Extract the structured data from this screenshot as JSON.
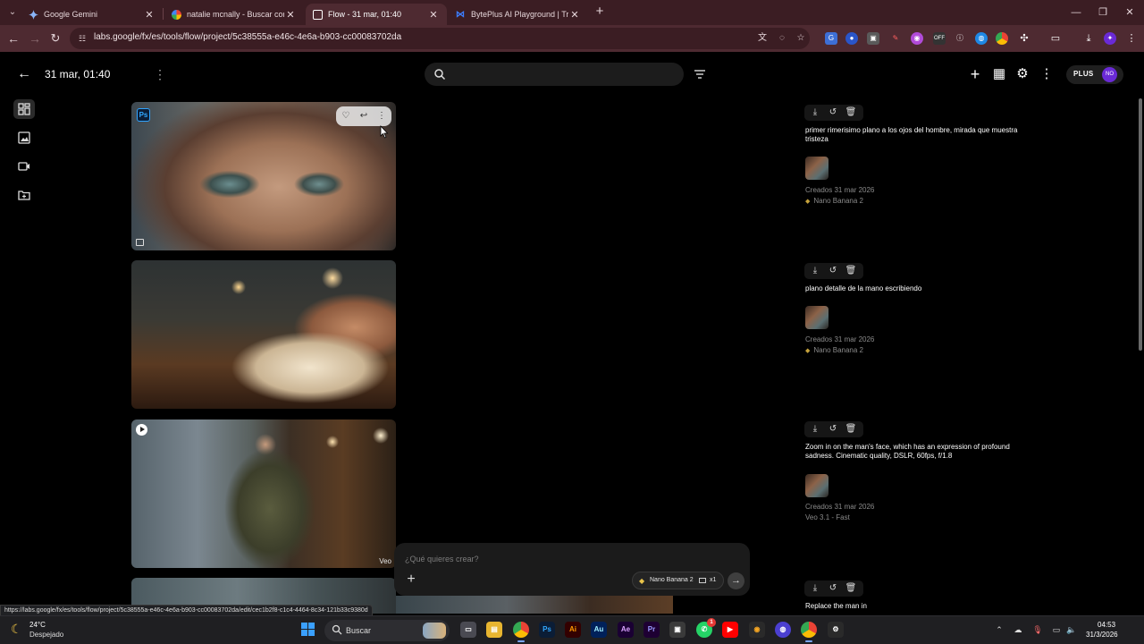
{
  "browser": {
    "tabs": [
      {
        "title": "Google Gemini",
        "active": false
      },
      {
        "title": "natalie mcnally - Buscar con Go",
        "active": false
      },
      {
        "title": "Flow - 31 mar, 01:40",
        "active": true
      },
      {
        "title": "BytePlus AI Playground | Try Ac",
        "active": false
      }
    ],
    "url": "labs.google/fx/es/tools/flow/project/5c38555a-e46c-4e6a-b903-cc00083702da"
  },
  "header": {
    "project_title": "31 mar, 01:40",
    "search_placeholder": "",
    "plan_badge": "PLUS",
    "avatar_text": "NO"
  },
  "gallery": {
    "items": [
      {
        "kind": "image",
        "badge": "Ps",
        "tag": ""
      },
      {
        "kind": "image",
        "badge": "",
        "tag": ""
      },
      {
        "kind": "video",
        "badge": "",
        "tag": "Veo"
      }
    ]
  },
  "composer": {
    "placeholder": "¿Qué quieres crear?",
    "model": "Nano Banana 2",
    "count": "x1"
  },
  "history": [
    {
      "prompt": "primer rimerisimo plano a los ojos del hombre, mirada que muestra tristeza",
      "date": "Creados 31 mar 2026",
      "model": "Nano Banana 2",
      "banana": true
    },
    {
      "prompt": "plano detalle de la mano escribiendo",
      "date": "Creados 31 mar 2026",
      "model": "Nano Banana 2",
      "banana": true
    },
    {
      "prompt": "Zoom in on the man's face, which has an expression of profound sadness. Cinematic quality, DSLR, 60fps, f/1.8",
      "date": "Creados 31 mar 2026",
      "model": "Veo 3.1 - Fast",
      "banana": false
    },
    {
      "prompt": "Replace the man in",
      "date": "",
      "model": "",
      "banana": false
    }
  ],
  "status_url": "https://labs.google/fx/es/tools/flow/project/5c38555a-e46c-4e6a-b903-cc00083702da/edit/cec1b2f8-c1c4-4464-8c34-121b33c9380d",
  "taskbar": {
    "weather_temp": "24°C",
    "weather_desc": "Despejado",
    "search_label": "Buscar",
    "time": "04:53",
    "date": "31/3/2026",
    "whatsapp_badge": "1"
  },
  "colors": {
    "tab_strip": "#3b1d23",
    "toolbar": "#4e2a31",
    "page_bg": "#000000",
    "avatar": "#6a2ad6"
  }
}
